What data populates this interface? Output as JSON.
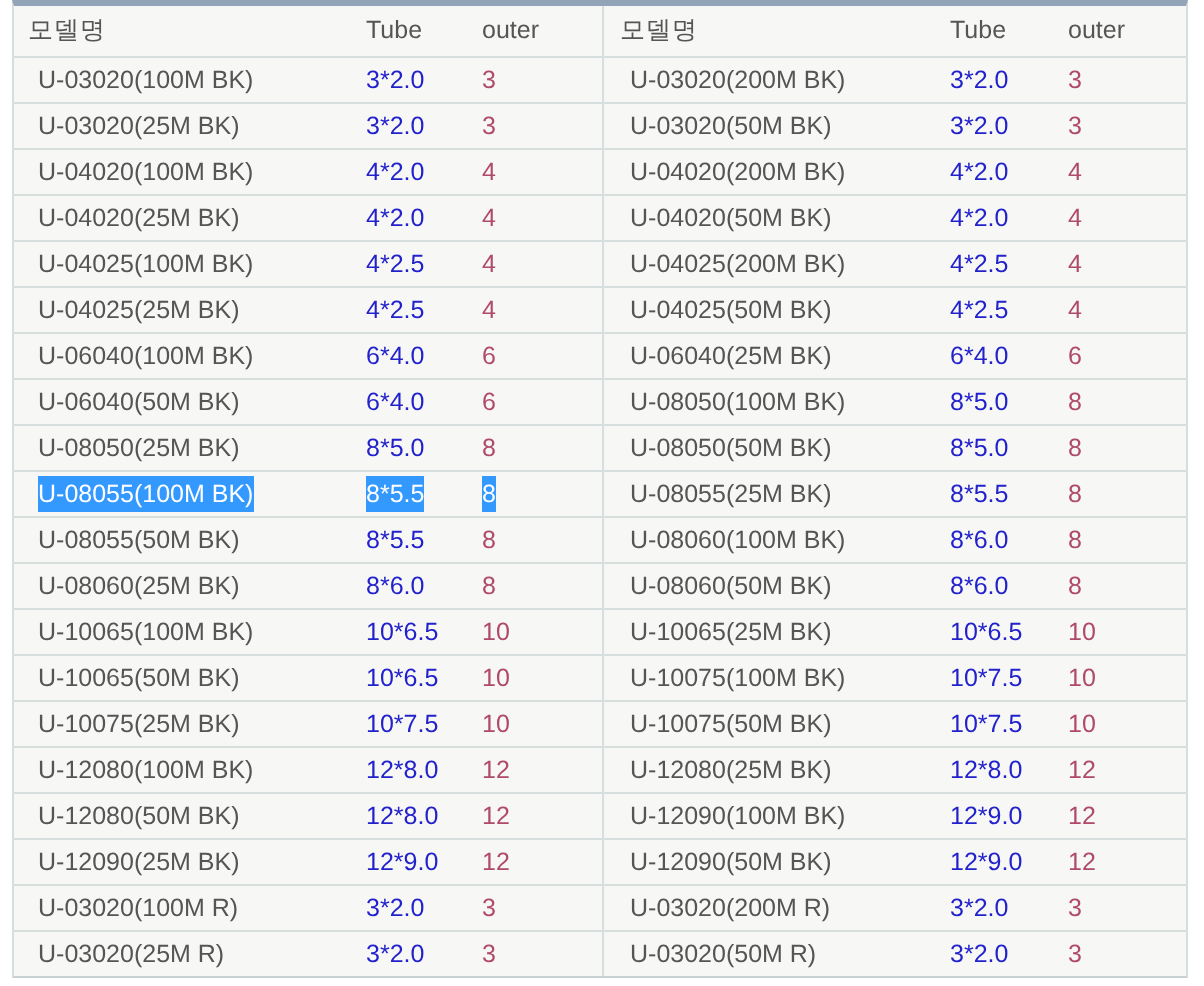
{
  "columns": [
    {
      "model": "모델명",
      "tube": "Tube",
      "outer": "outer"
    },
    {
      "model": "모델명",
      "tube": "Tube",
      "outer": "outer"
    }
  ],
  "rows": [
    [
      {
        "model": "U-03020(100M BK)",
        "tube": "3*2.0",
        "outer": "3",
        "selected": false
      },
      {
        "model": "U-03020(200M BK)",
        "tube": "3*2.0",
        "outer": "3",
        "selected": false
      }
    ],
    [
      {
        "model": "U-03020(25M BK)",
        "tube": "3*2.0",
        "outer": "3",
        "selected": false
      },
      {
        "model": "U-03020(50M BK)",
        "tube": "3*2.0",
        "outer": "3",
        "selected": false
      }
    ],
    [
      {
        "model": "U-04020(100M BK)",
        "tube": "4*2.0",
        "outer": "4",
        "selected": false
      },
      {
        "model": "U-04020(200M BK)",
        "tube": "4*2.0",
        "outer": "4",
        "selected": false
      }
    ],
    [
      {
        "model": "U-04020(25M BK)",
        "tube": "4*2.0",
        "outer": "4",
        "selected": false
      },
      {
        "model": "U-04020(50M BK)",
        "tube": "4*2.0",
        "outer": "4",
        "selected": false
      }
    ],
    [
      {
        "model": "U-04025(100M BK)",
        "tube": "4*2.5",
        "outer": "4",
        "selected": false
      },
      {
        "model": "U-04025(200M BK)",
        "tube": "4*2.5",
        "outer": "4",
        "selected": false
      }
    ],
    [
      {
        "model": "U-04025(25M BK)",
        "tube": "4*2.5",
        "outer": "4",
        "selected": false
      },
      {
        "model": "U-04025(50M BK)",
        "tube": "4*2.5",
        "outer": "4",
        "selected": false
      }
    ],
    [
      {
        "model": "U-06040(100M BK)",
        "tube": "6*4.0",
        "outer": "6",
        "selected": false
      },
      {
        "model": "U-06040(25M BK)",
        "tube": "6*4.0",
        "outer": "6",
        "selected": false
      }
    ],
    [
      {
        "model": "U-06040(50M BK)",
        "tube": "6*4.0",
        "outer": "6",
        "selected": false
      },
      {
        "model": "U-08050(100M BK)",
        "tube": "8*5.0",
        "outer": "8",
        "selected": false
      }
    ],
    [
      {
        "model": "U-08050(25M BK)",
        "tube": "8*5.0",
        "outer": "8",
        "selected": false
      },
      {
        "model": "U-08050(50M BK)",
        "tube": "8*5.0",
        "outer": "8",
        "selected": false
      }
    ],
    [
      {
        "model": "U-08055(100M BK)",
        "tube": "8*5.5",
        "outer": "8",
        "selected": true
      },
      {
        "model": "U-08055(25M BK)",
        "tube": "8*5.5",
        "outer": "8",
        "selected": false
      }
    ],
    [
      {
        "model": "U-08055(50M BK)",
        "tube": "8*5.5",
        "outer": "8",
        "selected": false
      },
      {
        "model": "U-08060(100M BK)",
        "tube": "8*6.0",
        "outer": "8",
        "selected": false
      }
    ],
    [
      {
        "model": "U-08060(25M BK)",
        "tube": "8*6.0",
        "outer": "8",
        "selected": false
      },
      {
        "model": "U-08060(50M BK)",
        "tube": "8*6.0",
        "outer": "8",
        "selected": false
      }
    ],
    [
      {
        "model": "U-10065(100M BK)",
        "tube": "10*6.5",
        "outer": "10",
        "selected": false
      },
      {
        "model": "U-10065(25M BK)",
        "tube": "10*6.5",
        "outer": "10",
        "selected": false
      }
    ],
    [
      {
        "model": "U-10065(50M BK)",
        "tube": "10*6.5",
        "outer": "10",
        "selected": false
      },
      {
        "model": "U-10075(100M BK)",
        "tube": "10*7.5",
        "outer": "10",
        "selected": false
      }
    ],
    [
      {
        "model": "U-10075(25M BK)",
        "tube": "10*7.5",
        "outer": "10",
        "selected": false
      },
      {
        "model": "U-10075(50M BK)",
        "tube": "10*7.5",
        "outer": "10",
        "selected": false
      }
    ],
    [
      {
        "model": "U-12080(100M BK)",
        "tube": "12*8.0",
        "outer": "12",
        "selected": false
      },
      {
        "model": "U-12080(25M BK)",
        "tube": "12*8.0",
        "outer": "12",
        "selected": false
      }
    ],
    [
      {
        "model": "U-12080(50M BK)",
        "tube": "12*8.0",
        "outer": "12",
        "selected": false
      },
      {
        "model": "U-12090(100M BK)",
        "tube": "12*9.0",
        "outer": "12",
        "selected": false
      }
    ],
    [
      {
        "model": "U-12090(25M BK)",
        "tube": "12*9.0",
        "outer": "12",
        "selected": false
      },
      {
        "model": "U-12090(50M BK)",
        "tube": "12*9.0",
        "outer": "12",
        "selected": false
      }
    ],
    [
      {
        "model": "U-03020(100M R)",
        "tube": "3*2.0",
        "outer": "3",
        "selected": false
      },
      {
        "model": "U-03020(200M R)",
        "tube": "3*2.0",
        "outer": "3",
        "selected": false
      }
    ],
    [
      {
        "model": "U-03020(25M R)",
        "tube": "3*2.0",
        "outer": "3",
        "selected": false
      },
      {
        "model": "U-03020(50M R)",
        "tube": "3*2.0",
        "outer": "3",
        "selected": false
      }
    ]
  ]
}
